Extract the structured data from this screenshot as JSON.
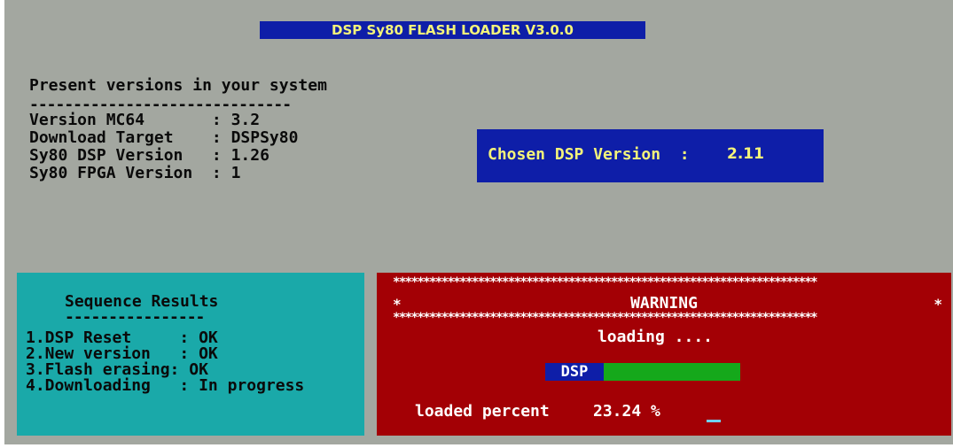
{
  "window": {
    "title": "DSP Sy80 FLASH LOADER V3.0.0"
  },
  "present_versions": {
    "heading": "Present versions in your system",
    "rule": "------------------------------",
    "lines": [
      "Version MC64       : 3.2",
      "Download Target    : DSPSy80",
      "Sy80 DSP Version   : 1.26",
      "Sy80 FPGA Version  : 1"
    ]
  },
  "chosen": {
    "label": "Chosen DSP Version  :",
    "value": "2.11"
  },
  "sequence_results": {
    "title": "Sequence Results",
    "rule": "----------------",
    "steps": [
      "1.DSP Reset     : OK",
      "2.New version   : OK",
      "3.Flash erasing: OK",
      "4.Downloading   : In progress"
    ]
  },
  "warning_panel": {
    "stars": "**********************************************************************",
    "edge_star": "*",
    "title": "WARNING",
    "status": "loading ....",
    "progress_tag": "DSP",
    "progress_fraction": 1.0,
    "percent_label": "loaded percent",
    "percent_value": "23.24 %",
    "colors": {
      "panel": "#a30005",
      "progress_fill": "#15a81b",
      "tag": "#0e1ea8"
    }
  }
}
